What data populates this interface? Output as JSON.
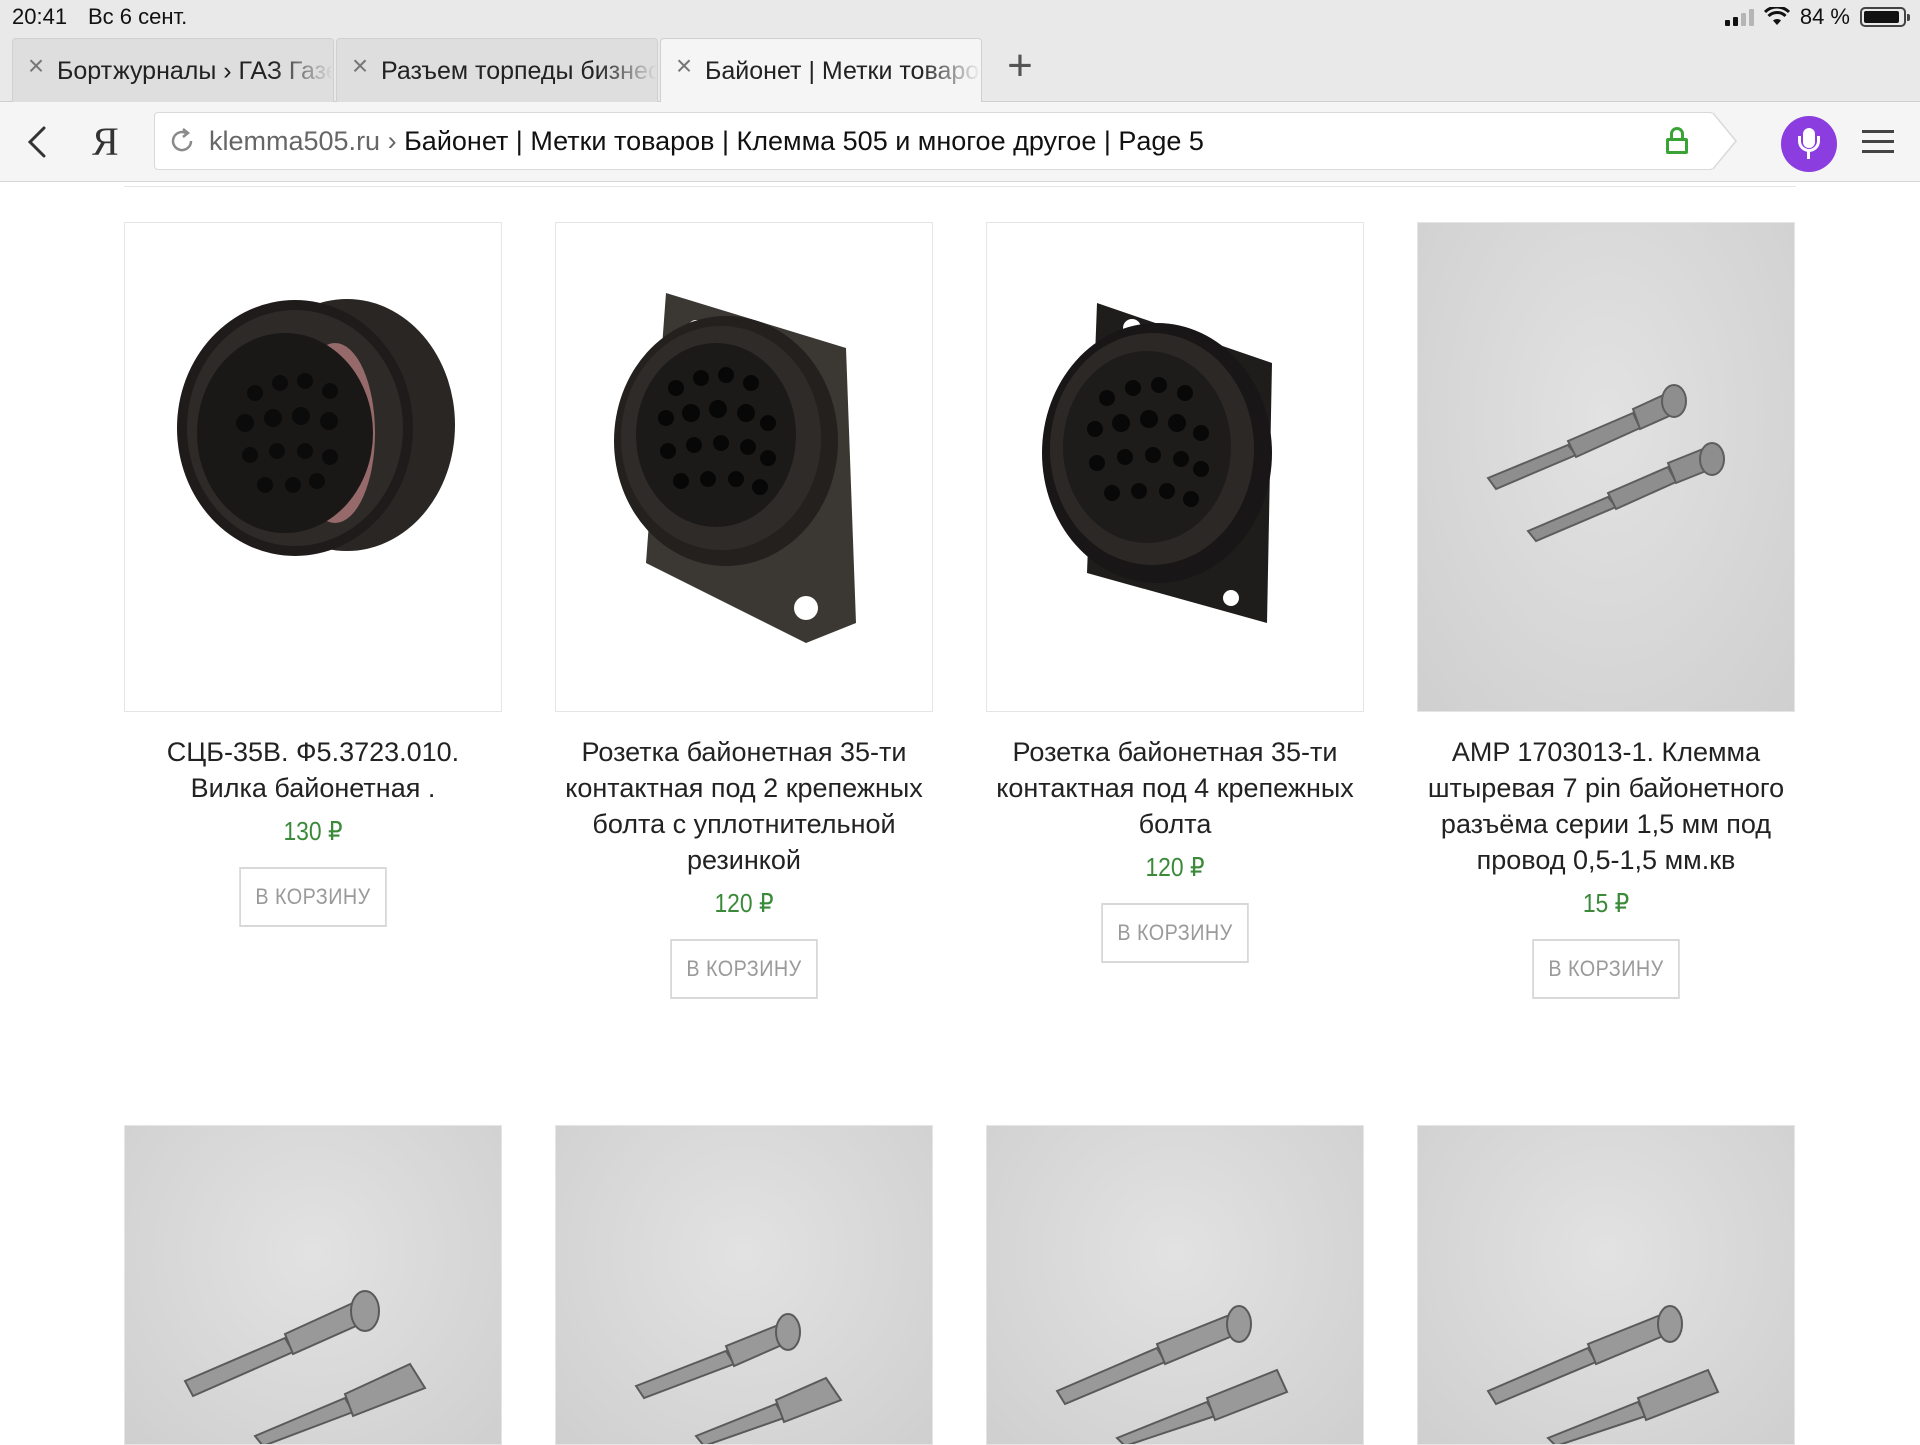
{
  "status_bar": {
    "time": "20:41",
    "date": "Вс 6 сент.",
    "battery_percent": "84 %",
    "battery_level": 0.84
  },
  "tabs": [
    {
      "label": "Бортжурналы › ГАЗ Газель",
      "active": false
    },
    {
      "label": "Разъем торпеды бизнес",
      "active": false
    },
    {
      "label": "Байонет | Метки товаров",
      "active": true
    }
  ],
  "toolbar": {
    "browser_logo": "Я",
    "url_domain": "klemma505.ru",
    "url_separator": " › ",
    "url_title": "Байонет | Метки товаров | Клемма 505 и многое другое | Page 5",
    "accent_color": "#8b3de0"
  },
  "products": [
    {
      "title": "СЦБ-35В. Ф5.3723.010. Вилка байонетная .",
      "price": "130 ₽",
      "button": "В КОРЗИНУ",
      "image": "black-round-bayonet-plug"
    },
    {
      "title": "Розетка байонетная 35-ти контактная под 2 крепежных болта с уплотнительной резинкой",
      "price": "120 ₽",
      "button": "В КОРЗИНУ",
      "image": "bayonet-socket-2-bolt"
    },
    {
      "title": "Розетка байонетная 35-ти контактная под 4 крепежных болта",
      "price": "120 ₽",
      "button": "В КОРЗИНУ",
      "image": "bayonet-socket-4-bolt"
    },
    {
      "title": "AMP 1703013-1. Клемма штыревая 7 pin байонетного разъёма серии 1,5 мм под провод 0,5-1,5 мм.кв",
      "price": "15 ₽",
      "button": "В КОРЗИНУ",
      "image": "pin-terminals"
    }
  ],
  "products_row2": [
    {
      "image": "terminal-pair"
    },
    {
      "image": "terminal-pair"
    },
    {
      "image": "terminal-pair"
    },
    {
      "image": "terminal-pair"
    }
  ],
  "colors": {
    "price": "#3a8a3a",
    "secure_lock": "#3aa335"
  }
}
